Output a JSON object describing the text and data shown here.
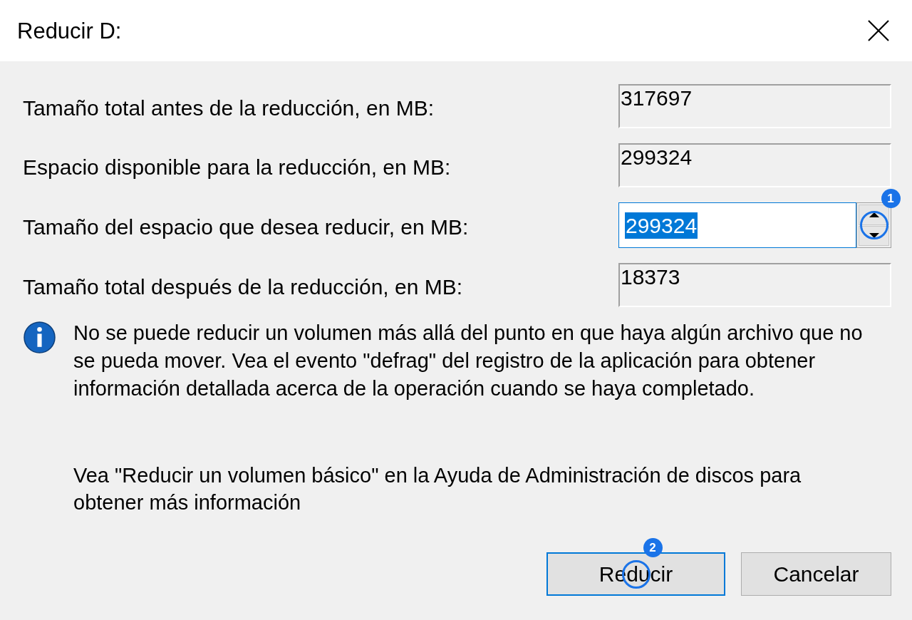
{
  "window": {
    "title": "Reducir D:"
  },
  "fields": [
    {
      "kind": "readonly",
      "label": "Tamaño total antes de la reducción, en MB:",
      "value": "317697",
      "focused": false
    },
    {
      "kind": "readonly",
      "label": "Espacio disponible para la reducción, en MB:",
      "value": "299324",
      "focused": false
    },
    {
      "kind": "spin",
      "label": "Tamaño del espacio que desea reducir, en MB:",
      "value": "299324",
      "focused": true,
      "text_selected": true,
      "callout": "1"
    },
    {
      "kind": "readonly",
      "label": "Tamaño total después de la reducción, en MB:",
      "value": "18373",
      "focused": false
    }
  ],
  "info": {
    "message": "No se puede reducir un volumen más allá del punto en que haya algún archivo que no se pueda mover. Vea el evento \"defrag\" del registro de la aplicación para obtener información detallada acerca de la operación cuando se haya completado.",
    "help": "Vea \"Reducir un volumen básico\" en la Ayuda de Administración de discos para obtener más información"
  },
  "buttons": [
    {
      "label": "Reducir",
      "default": true,
      "callout": "2"
    },
    {
      "label": "Cancelar",
      "default": false
    }
  ]
}
